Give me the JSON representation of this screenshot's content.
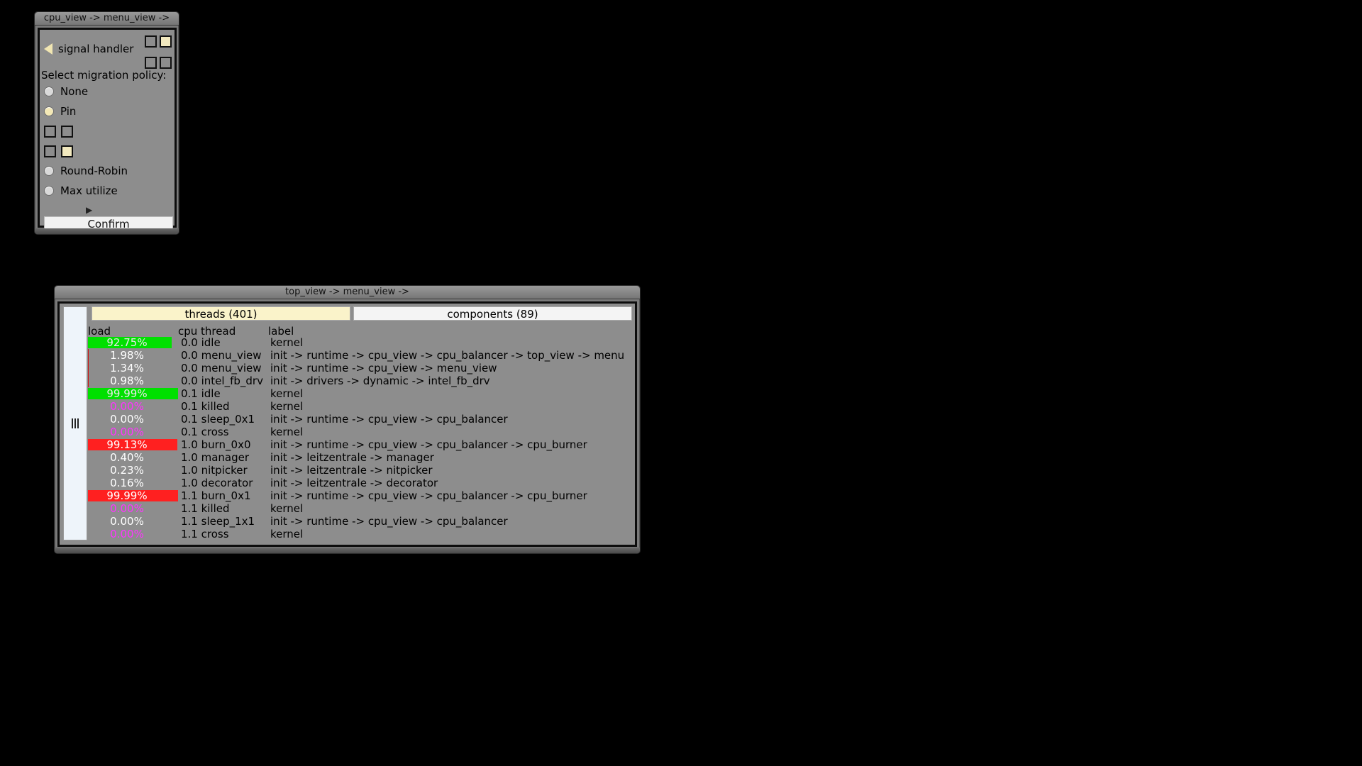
{
  "menu_window": {
    "title": "cpu_view -> menu_view ->",
    "signal_handler_label": "signal handler",
    "policy_label": "Select migration policy:",
    "options": [
      {
        "label": "None",
        "selected": false
      },
      {
        "label": "Pin",
        "selected": true
      },
      {
        "label": "Round-Robin",
        "selected": false
      },
      {
        "label": "Max utilize",
        "selected": false
      }
    ],
    "confirm_label": "Confirm"
  },
  "top_window": {
    "title": "top_view -> menu_view ->",
    "tabs": [
      {
        "label": "threads (401)",
        "active": true
      },
      {
        "label": "components (89)",
        "active": false
      }
    ],
    "columns": [
      "load",
      "cpu thread",
      "label"
    ],
    "rows": [
      {
        "load": "92.75%",
        "load_value": 92.75,
        "bar_color": "#00e000",
        "text_color": "#e8e8e8",
        "cpu": "0.0 idle",
        "label": "kernel"
      },
      {
        "load": "1.98%",
        "load_value": 1.98,
        "bar_color": "",
        "text_color": "#ffffff",
        "cpu": "0.0 menu_view",
        "label": "init -> runtime -> cpu_view -> cpu_balancer -> top_view -> menu"
      },
      {
        "load": "1.34%",
        "load_value": 1.34,
        "bar_color": "",
        "text_color": "#ffffff",
        "cpu": "0.0 menu_view",
        "label": "init -> runtime -> cpu_view -> menu_view"
      },
      {
        "load": "0.98%",
        "load_value": 0.98,
        "bar_color": "",
        "text_color": "#ffffff",
        "cpu": "0.0 intel_fb_drv",
        "label": "init -> drivers -> dynamic -> intel_fb_drv"
      },
      {
        "load": "99.99%",
        "load_value": 99.99,
        "bar_color": "#00e000",
        "text_color": "#e8e8e8",
        "cpu": "0.1 idle",
        "label": "kernel"
      },
      {
        "load": "0.00%",
        "load_value": 0,
        "bar_color": "",
        "text_color": "#ff33ff",
        "cpu": "0.1 killed",
        "label": "kernel"
      },
      {
        "load": "0.00%",
        "load_value": 0,
        "bar_color": "",
        "text_color": "#ffffff",
        "cpu": "0.1 sleep_0x1",
        "label": "init -> runtime -> cpu_view -> cpu_balancer"
      },
      {
        "load": "0.00%",
        "load_value": 0,
        "bar_color": "",
        "text_color": "#ff33ff",
        "cpu": "0.1 cross",
        "label": "kernel"
      },
      {
        "load": "99.13%",
        "load_value": 99.13,
        "bar_color": "#ff2020",
        "text_color": "#ffffff",
        "cpu": "1.0 burn_0x0",
        "label": "init -> runtime -> cpu_view -> cpu_balancer -> cpu_burner"
      },
      {
        "load": "0.40%",
        "load_value": 0.4,
        "bar_color": "",
        "text_color": "#ffffff",
        "cpu": "1.0 manager",
        "label": "init -> leitzentrale -> manager"
      },
      {
        "load": "0.23%",
        "load_value": 0.23,
        "bar_color": "",
        "text_color": "#ffffff",
        "cpu": "1.0 nitpicker",
        "label": "init -> leitzentrale -> nitpicker"
      },
      {
        "load": "0.16%",
        "load_value": 0.16,
        "bar_color": "",
        "text_color": "#ffffff",
        "cpu": "1.0 decorator",
        "label": "init -> leitzentrale -> decorator"
      },
      {
        "load": "99.99%",
        "load_value": 99.99,
        "bar_color": "#ff2020",
        "text_color": "#ffffff",
        "cpu": "1.1 burn_0x1",
        "label": "init -> runtime -> cpu_view -> cpu_balancer -> cpu_burner"
      },
      {
        "load": "0.00%",
        "load_value": 0,
        "bar_color": "",
        "text_color": "#ff33ff",
        "cpu": "1.1 killed",
        "label": "kernel"
      },
      {
        "load": "0.00%",
        "load_value": 0,
        "bar_color": "",
        "text_color": "#ffffff",
        "cpu": "1.1 sleep_1x1",
        "label": "init -> runtime -> cpu_view -> cpu_balancer"
      },
      {
        "load": "0.00%",
        "load_value": 0,
        "bar_color": "",
        "text_color": "#ff33ff",
        "cpu": "1.1 cross",
        "label": "kernel"
      }
    ]
  }
}
